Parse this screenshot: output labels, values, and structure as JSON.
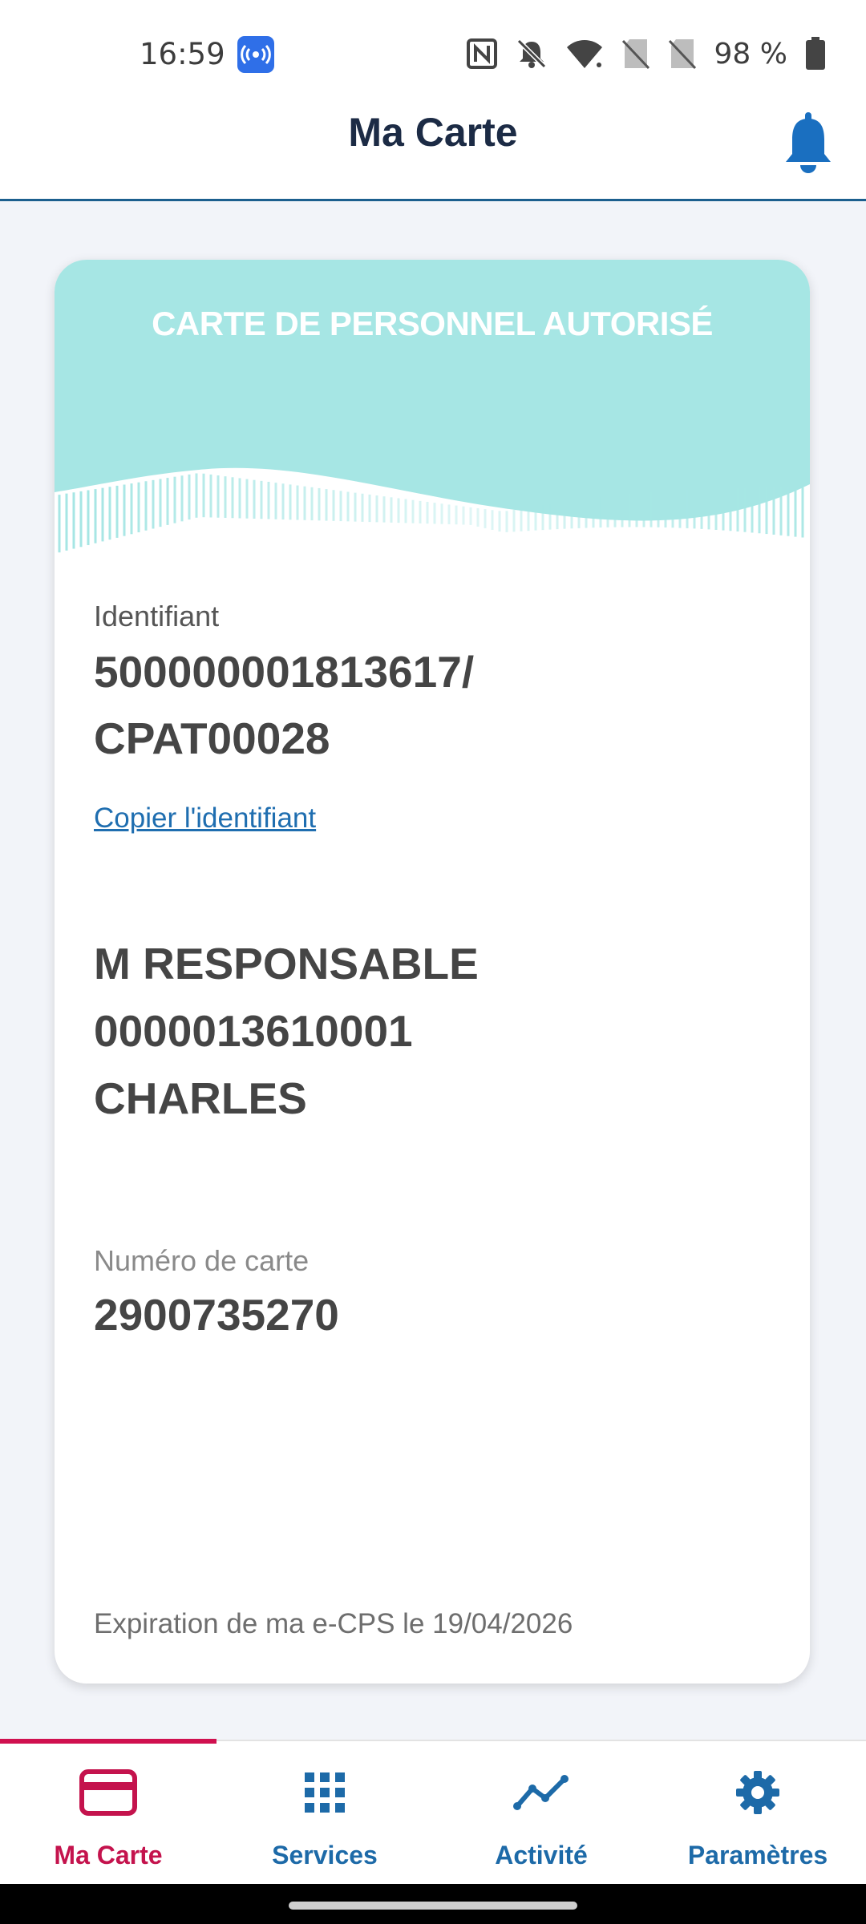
{
  "status_bar": {
    "time": "16:59",
    "battery": "98 %",
    "icons": [
      "cast-icon",
      "nfc-icon",
      "bell-off-icon",
      "wifi-icon",
      "no-sim-icon",
      "no-sim-icon",
      "battery-icon"
    ]
  },
  "header": {
    "title": "Ma Carte",
    "bell_icon": "bell-icon"
  },
  "card": {
    "title": "CARTE DE PERSONNEL AUTORISÉ",
    "identifier_label": "Identifiant",
    "identifier_line1": "500000001813617/",
    "identifier_line2": "CPAT00028",
    "copy_link": "Copier l'identifiant",
    "holder_line1": "M RESPONSABLE",
    "holder_line2": "0000013610001",
    "holder_line3": "CHARLES",
    "card_number_label": "Numéro de carte",
    "card_number": "2900735270",
    "expiry": "Expiration de ma e-CPS le 19/04/2026"
  },
  "bottom_nav": {
    "items": [
      {
        "label": "Ma Carte",
        "icon": "card-icon",
        "active": true
      },
      {
        "label": "Services",
        "icon": "grid-icon",
        "active": false
      },
      {
        "label": "Activité",
        "icon": "activity-icon",
        "active": false
      },
      {
        "label": "Paramètres",
        "icon": "gear-icon",
        "active": false
      }
    ]
  },
  "colors": {
    "banner": "#a6e6e4",
    "title": "#1c2b45",
    "nav_active": "#c4134d",
    "nav_inactive": "#1d6aa8",
    "link": "#1f6eb0"
  }
}
